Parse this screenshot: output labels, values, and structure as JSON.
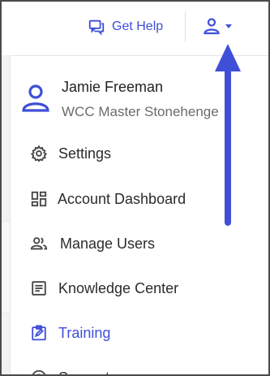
{
  "header": {
    "help_label": "Get Help"
  },
  "profile": {
    "name": "Jamie Freeman",
    "org": "WCC Master Stonehenge"
  },
  "menu": {
    "items": [
      {
        "label": "Settings",
        "icon": "gear-icon"
      },
      {
        "label": "Account Dashboard",
        "icon": "dashboard-icon"
      },
      {
        "label": "Manage Users",
        "icon": "users-icon"
      },
      {
        "label": "Knowledge Center",
        "icon": "article-icon"
      },
      {
        "label": "Training",
        "icon": "training-icon",
        "active": true
      },
      {
        "label": "Support",
        "icon": "support-icon"
      }
    ]
  },
  "colors": {
    "accent": "#3f4fd8",
    "text": "#2b2b2b",
    "muted": "#6b6b6b",
    "border": "#4a4a4a"
  }
}
